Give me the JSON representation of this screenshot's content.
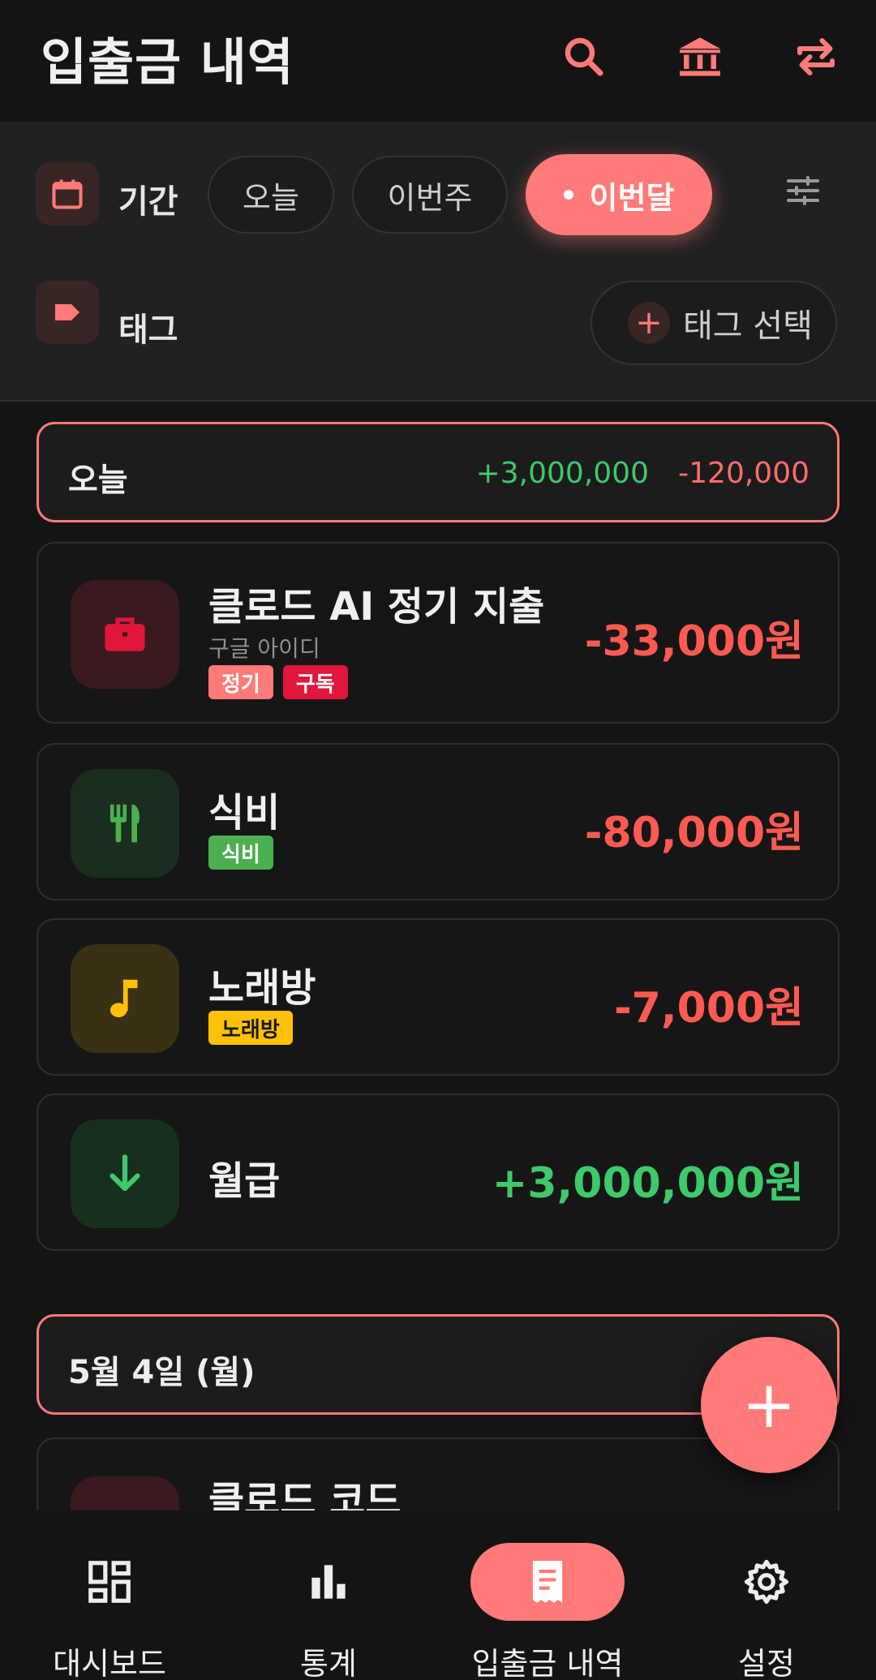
{
  "header": {
    "title": "입출금 내역",
    "icons": [
      "search-icon",
      "bank-icon",
      "swap-icon"
    ]
  },
  "filter": {
    "period_label": "기간",
    "period_options": [
      "오늘",
      "이번주",
      "이번달"
    ],
    "selected_period": "이번달",
    "tag_label": "태그",
    "tag_select_label": "태그 선택"
  },
  "groups": [
    {
      "date": "오늘",
      "income": "+3,000,000",
      "expense": "-120,000",
      "transactions": [
        {
          "name": "클로드 AI 정기 지출",
          "sub": "구글 아이디",
          "tags": [
            "정기",
            "구독"
          ],
          "amount": "-33,000원",
          "icon": "briefcase-icon"
        },
        {
          "name": "식비",
          "tags": [
            "식비"
          ],
          "amount": "-80,000원",
          "icon": "fork-knife-icon"
        },
        {
          "name": "노래방",
          "tags": [
            "노래방"
          ],
          "amount": "-7,000원",
          "icon": "music-note-icon"
        },
        {
          "name": "월급",
          "tags": [],
          "amount": "+3,000,000원",
          "icon": "arrow-down-icon"
        }
      ]
    },
    {
      "date": "5월 4일 (월)",
      "transactions": [
        {
          "name": "클로드 코드"
        }
      ]
    }
  ],
  "colors": {
    "accent": "#ff7a78",
    "income": "#3ec96a",
    "expense": "#ff5a52",
    "tag_regular": "#ff7a78",
    "tag_subscription": "#e0163a",
    "tag_food": "#4caf50",
    "tag_karaoke": "#ffc107"
  },
  "fab": {
    "label": "+"
  },
  "nav": [
    {
      "label": "대시보드",
      "icon": "dashboard-icon"
    },
    {
      "label": "통계",
      "icon": "bar-chart-icon"
    },
    {
      "label": "입출금 내역",
      "icon": "receipt-icon",
      "active": true
    },
    {
      "label": "설정",
      "icon": "gear-icon"
    }
  ]
}
